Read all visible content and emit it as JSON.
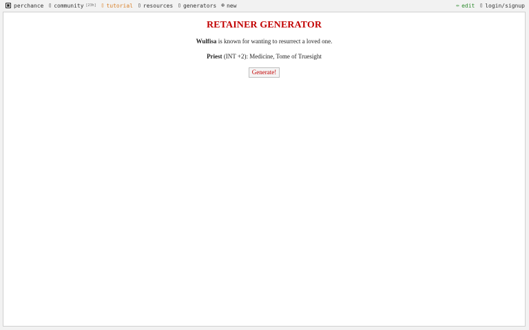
{
  "topbar": {
    "left": [
      {
        "icon": "dice-icon",
        "label": "perchance"
      },
      {
        "icon": "chat-icon",
        "glyph": "▯",
        "label": "community",
        "count": "[23h]"
      },
      {
        "icon": "book-icon",
        "glyph": "▯",
        "label": "tutorial"
      },
      {
        "icon": "resources-icon",
        "glyph": "▯",
        "label": "resources"
      },
      {
        "icon": "generators-icon",
        "glyph": "▯",
        "label": "generators"
      },
      {
        "icon": "plus-circle-icon",
        "glyph": "⊕",
        "label": "new"
      }
    ],
    "right": [
      {
        "icon": "pencil-icon",
        "glyph": "✏",
        "label": "edit"
      },
      {
        "icon": "user-icon",
        "glyph": "▯",
        "label": "login/signup"
      }
    ],
    "colors": {
      "tutorial": "#d9822b",
      "edit": "#2e8b2e"
    }
  },
  "main": {
    "title": "RETAINER GENERATOR",
    "name": "Wulfisa",
    "motive": "is known for wanting to resurrect a loved one.",
    "class_name": "Priest",
    "class_detail": "(INT +2): Medicine, Tome of Truesight",
    "button": "Generate!",
    "title_color": "#c20000"
  }
}
